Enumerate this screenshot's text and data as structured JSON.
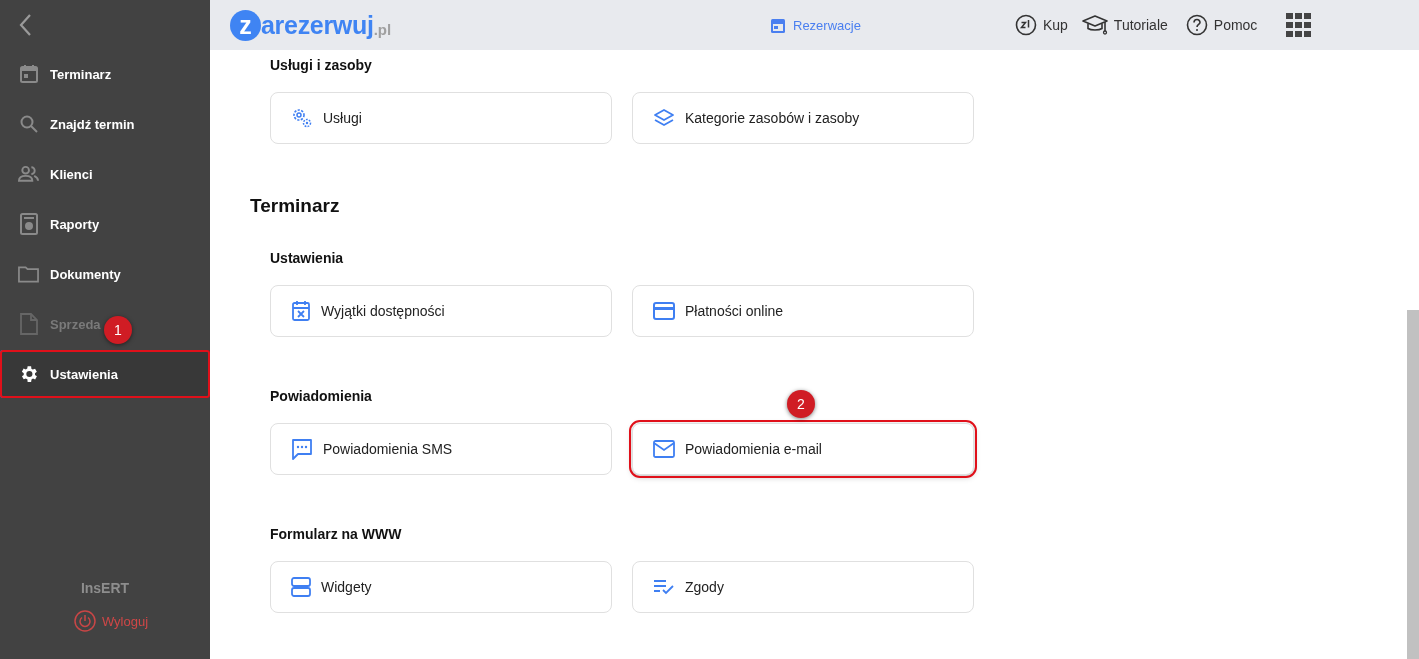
{
  "sidebar": {
    "items": [
      {
        "label": "Terminarz",
        "selected": false,
        "disabled": false,
        "highlighted": false
      },
      {
        "label": "Znajdź termin",
        "selected": false,
        "disabled": false,
        "highlighted": false
      },
      {
        "label": "Klienci",
        "selected": false,
        "disabled": false,
        "highlighted": false
      },
      {
        "label": "Raporty",
        "selected": false,
        "disabled": false,
        "highlighted": false
      },
      {
        "label": "Dokumenty",
        "selected": false,
        "disabled": false,
        "highlighted": false
      },
      {
        "label": "Sprzeda",
        "selected": false,
        "disabled": true,
        "highlighted": false
      },
      {
        "label": "Ustawienia",
        "selected": true,
        "disabled": false,
        "highlighted": true,
        "callout": "1"
      }
    ],
    "brand": "InsERT",
    "logout": "Wyloguj"
  },
  "topbar": {
    "logo": {
      "mark": "z",
      "name": "arezerwuj",
      "suffix": ".pl"
    },
    "nav": [
      {
        "label": "Rezerwacje",
        "selected": true
      }
    ],
    "links": [
      {
        "label": "Kup"
      },
      {
        "label": "Tutoriale"
      },
      {
        "label": "Pomoc"
      }
    ]
  },
  "content": {
    "blocks": [
      {
        "kind": "group",
        "title": "Usługi i zasoby",
        "cards": [
          {
            "label": "Usługi",
            "highlighted": false
          },
          {
            "label": "Kategorie zasobów i zasoby",
            "highlighted": false
          }
        ]
      },
      {
        "kind": "heading",
        "title": "Terminarz"
      },
      {
        "kind": "group",
        "title": "Ustawienia",
        "cards": [
          {
            "label": "Wyjątki dostępności",
            "highlighted": false
          },
          {
            "label": "Płatności online",
            "highlighted": false
          }
        ]
      },
      {
        "kind": "group",
        "title": "Powiadomienia",
        "cards": [
          {
            "label": "Powiadomienia SMS",
            "highlighted": false
          },
          {
            "label": "Powiadomienia e-mail",
            "highlighted": true,
            "callout": "2"
          }
        ]
      },
      {
        "kind": "group",
        "title": "Formularz na WWW",
        "cards": [
          {
            "label": "Widgety",
            "highlighted": false
          },
          {
            "label": "Zgody",
            "highlighted": false
          }
        ]
      }
    ]
  }
}
